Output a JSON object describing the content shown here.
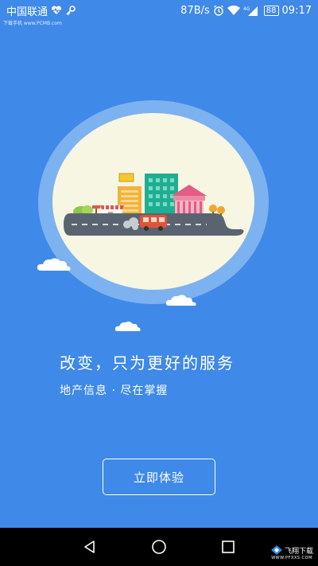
{
  "status_bar": {
    "carrier": "中国联通",
    "net_speed": "87B/s",
    "network": "4G",
    "battery": "88",
    "time": "09:17",
    "icons": [
      "heart-pulse-icon",
      "key-icon",
      "alarm-icon",
      "wifi-icon",
      "signal-icon"
    ]
  },
  "ad_strip": {
    "text": "下载手机 www.PCMB.com"
  },
  "main": {
    "slogan": "改变，只为更好的服务",
    "subtitle": "地产信息 · 尽在掌握",
    "start_button_label": "立即体验"
  },
  "nav_bar": {
    "buttons": [
      "back-icon",
      "home-icon",
      "recents-icon"
    ]
  },
  "watermark": {
    "text": "飞翔下载",
    "url": "WWW.PFXXS.COM"
  },
  "colors": {
    "background": "#3f89e8",
    "halo": "#7cb2ef",
    "disc": "#f7f6e3",
    "road": "#5a6470"
  }
}
